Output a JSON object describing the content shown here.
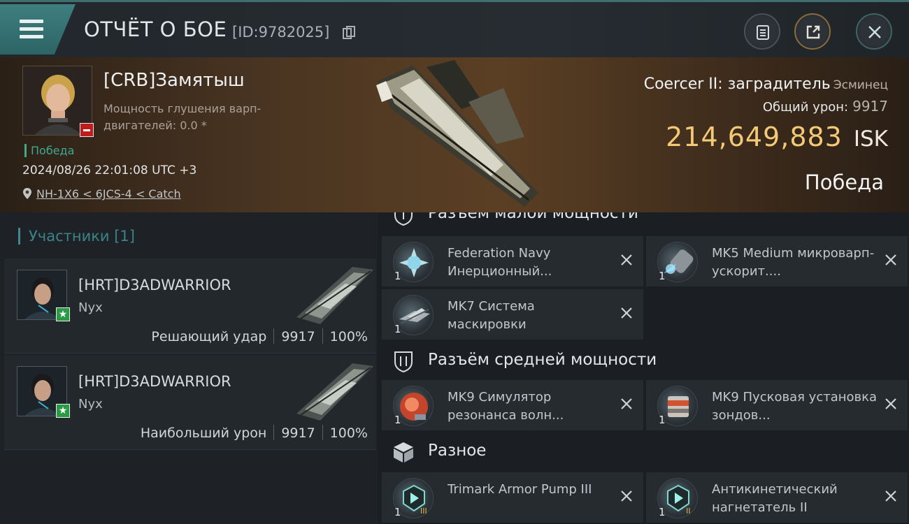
{
  "topbar": {
    "title": "ОТЧЁТ О БОЕ",
    "report_id": "[ID:9782025]"
  },
  "victim": {
    "name": "[CRB]Замятыш",
    "warp_label": "Мощность глушения варп-двигателей: 0.0 *",
    "result_tag": "Победа",
    "datetime": "2024/08/26 22:01:08 UTC +3",
    "location": "NH-1X6 < 6JCS-4 < Catch",
    "ship_name": "Coercer II: заградитель",
    "ship_class": "Эсминец",
    "damage_label": "Общий урон:",
    "damage_value": "9917",
    "isk_value": "214,649,883",
    "isk_unit": "ISK",
    "result": "Победа"
  },
  "participants": {
    "header": "Участники [1]",
    "items": [
      {
        "name": "[HRT]D3ADWARRIOR",
        "ship": "Nyx",
        "role": "Решающий удар",
        "damage": "9917",
        "percent": "100%"
      },
      {
        "name": "[HRT]D3ADWARRIOR",
        "ship": "Nyx",
        "role": "Наибольший урон",
        "damage": "9917",
        "percent": "100%"
      }
    ]
  },
  "fitting": {
    "low_slot": {
      "title": "Разъем малой мощности",
      "modules": [
        {
          "name": "Federation Navy Инерционный...",
          "qty": "1",
          "icon": "inertial-stabilizer-icon"
        },
        {
          "name": "MK5 Medium микроварп-ускорит....",
          "qty": "1",
          "icon": "microwarpdrive-icon"
        },
        {
          "name": "MK7 Система маскировки",
          "qty": "1",
          "icon": "cloaking-device-icon"
        }
      ]
    },
    "mid_slot": {
      "title": "Разъём средней мощности",
      "modules": [
        {
          "name": "MK9 Симулятор резонанса волн...",
          "qty": "1",
          "icon": "wave-resonance-icon"
        },
        {
          "name": "MK9 Пусковая установка зондов...",
          "qty": "1",
          "icon": "probe-launcher-icon"
        }
      ]
    },
    "misc": {
      "title": "Разное",
      "modules": [
        {
          "name": "Trimark Armor Pump III",
          "qty": "1",
          "icon": "armor-pump-icon",
          "tier": "III"
        },
        {
          "name": "Антикинетический нагнетатель II",
          "qty": "1",
          "icon": "anti-kinetic-pump-icon",
          "tier": "II"
        }
      ]
    }
  },
  "colors": {
    "accent_teal": "#3e7f80",
    "isk_gold": "#f3c977",
    "victory_green": "#3fa98f",
    "loss_red": "#c01c1c"
  }
}
